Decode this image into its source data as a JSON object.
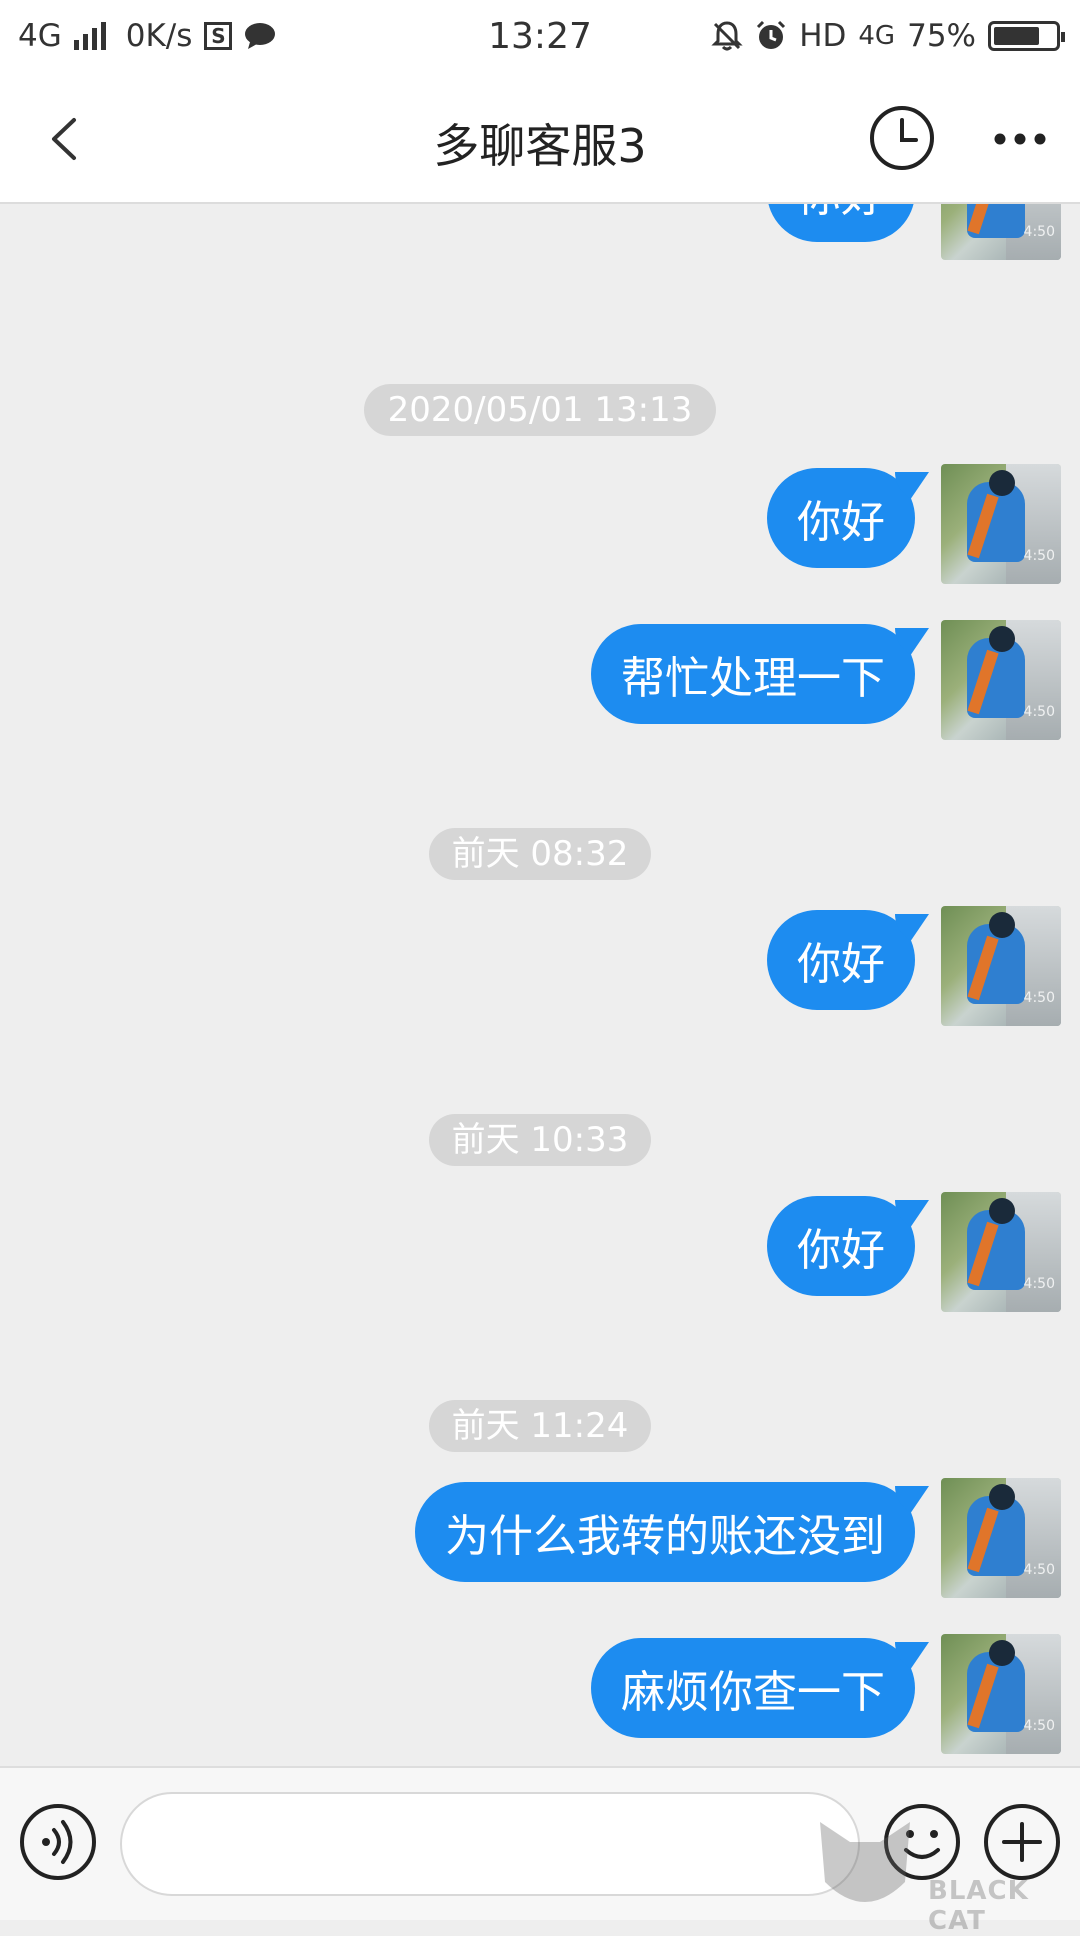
{
  "status_bar": {
    "network": "4G",
    "speed": "0K/s",
    "time": "13:27",
    "hd": "HD",
    "network_right": "4G",
    "battery": "75%",
    "battery_level": 0.75
  },
  "header": {
    "title": "多聊客服3"
  },
  "chat": {
    "messages": [
      {
        "type": "sent",
        "text": "你好"
      },
      {
        "type": "time",
        "text": "2020/05/01 13:13"
      },
      {
        "type": "sent",
        "text": "你好"
      },
      {
        "type": "sent",
        "text": "帮忙处理一下"
      },
      {
        "type": "time",
        "text": "前天 08:32"
      },
      {
        "type": "sent",
        "text": "你好"
      },
      {
        "type": "time",
        "text": "前天 10:33"
      },
      {
        "type": "sent",
        "text": "你好"
      },
      {
        "type": "time",
        "text": "前天 11:24"
      },
      {
        "type": "sent",
        "text": "为什么我转的账还没到"
      },
      {
        "type": "sent",
        "text": "麻烦你查一下"
      }
    ],
    "avatar_stamp": "4:50"
  },
  "watermark": {
    "text": "BLACK CAT"
  },
  "colors": {
    "bubble": "#1d8cf0",
    "background": "#eeeeee"
  }
}
